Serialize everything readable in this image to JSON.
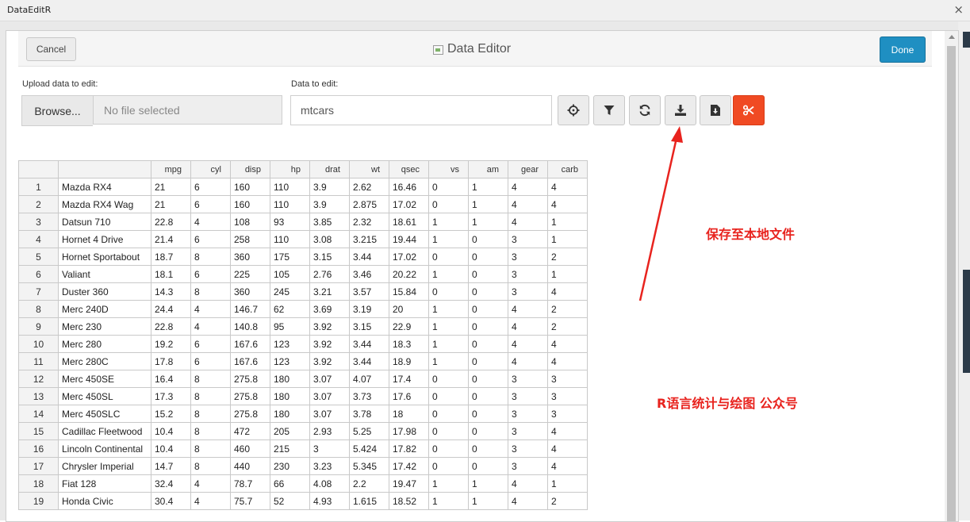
{
  "window": {
    "title": "DataEditR",
    "close_glyph": "×"
  },
  "header": {
    "cancel_label": "Cancel",
    "title": "Data Editor",
    "done_label": "Done"
  },
  "upload": {
    "label": "Upload data to edit:",
    "browse_label": "Browse...",
    "file_placeholder": "No file selected"
  },
  "data_select": {
    "label": "Data to edit:",
    "value": "mtcars"
  },
  "toolbar": {
    "icons": [
      "crosshairs-icon",
      "filter-icon",
      "sync-icon",
      "download-icon",
      "file-download-icon",
      "cut-icon"
    ]
  },
  "colors": {
    "done": "#1f8fc2",
    "cut": "#f04a23",
    "annotation": "#e8231e"
  },
  "table": {
    "columns": [
      "",
      "",
      "mpg",
      "cyl",
      "disp",
      "hp",
      "drat",
      "wt",
      "qsec",
      "vs",
      "am",
      "gear",
      "carb"
    ],
    "rows": [
      [
        "1",
        "Mazda RX4",
        "21",
        "6",
        "160",
        "110",
        "3.9",
        "2.62",
        "16.46",
        "0",
        "1",
        "4",
        "4"
      ],
      [
        "2",
        "Mazda RX4 Wag",
        "21",
        "6",
        "160",
        "110",
        "3.9",
        "2.875",
        "17.02",
        "0",
        "1",
        "4",
        "4"
      ],
      [
        "3",
        "Datsun 710",
        "22.8",
        "4",
        "108",
        "93",
        "3.85",
        "2.32",
        "18.61",
        "1",
        "1",
        "4",
        "1"
      ],
      [
        "4",
        "Hornet 4 Drive",
        "21.4",
        "6",
        "258",
        "110",
        "3.08",
        "3.215",
        "19.44",
        "1",
        "0",
        "3",
        "1"
      ],
      [
        "5",
        "Hornet Sportabout",
        "18.7",
        "8",
        "360",
        "175",
        "3.15",
        "3.44",
        "17.02",
        "0",
        "0",
        "3",
        "2"
      ],
      [
        "6",
        "Valiant",
        "18.1",
        "6",
        "225",
        "105",
        "2.76",
        "3.46",
        "20.22",
        "1",
        "0",
        "3",
        "1"
      ],
      [
        "7",
        "Duster 360",
        "14.3",
        "8",
        "360",
        "245",
        "3.21",
        "3.57",
        "15.84",
        "0",
        "0",
        "3",
        "4"
      ],
      [
        "8",
        "Merc 240D",
        "24.4",
        "4",
        "146.7",
        "62",
        "3.69",
        "3.19",
        "20",
        "1",
        "0",
        "4",
        "2"
      ],
      [
        "9",
        "Merc 230",
        "22.8",
        "4",
        "140.8",
        "95",
        "3.92",
        "3.15",
        "22.9",
        "1",
        "0",
        "4",
        "2"
      ],
      [
        "10",
        "Merc 280",
        "19.2",
        "6",
        "167.6",
        "123",
        "3.92",
        "3.44",
        "18.3",
        "1",
        "0",
        "4",
        "4"
      ],
      [
        "11",
        "Merc 280C",
        "17.8",
        "6",
        "167.6",
        "123",
        "3.92",
        "3.44",
        "18.9",
        "1",
        "0",
        "4",
        "4"
      ],
      [
        "12",
        "Merc 450SE",
        "16.4",
        "8",
        "275.8",
        "180",
        "3.07",
        "4.07",
        "17.4",
        "0",
        "0",
        "3",
        "3"
      ],
      [
        "13",
        "Merc 450SL",
        "17.3",
        "8",
        "275.8",
        "180",
        "3.07",
        "3.73",
        "17.6",
        "0",
        "0",
        "3",
        "3"
      ],
      [
        "14",
        "Merc 450SLC",
        "15.2",
        "8",
        "275.8",
        "180",
        "3.07",
        "3.78",
        "18",
        "0",
        "0",
        "3",
        "3"
      ],
      [
        "15",
        "Cadillac Fleetwood",
        "10.4",
        "8",
        "472",
        "205",
        "2.93",
        "5.25",
        "17.98",
        "0",
        "0",
        "3",
        "4"
      ],
      [
        "16",
        "Lincoln Continental",
        "10.4",
        "8",
        "460",
        "215",
        "3",
        "5.424",
        "17.82",
        "0",
        "0",
        "3",
        "4"
      ],
      [
        "17",
        "Chrysler Imperial",
        "14.7",
        "8",
        "440",
        "230",
        "3.23",
        "5.345",
        "17.42",
        "0",
        "0",
        "3",
        "4"
      ],
      [
        "18",
        "Fiat 128",
        "32.4",
        "4",
        "78.7",
        "66",
        "4.08",
        "2.2",
        "19.47",
        "1",
        "1",
        "4",
        "1"
      ],
      [
        "19",
        "Honda Civic",
        "30.4",
        "4",
        "75.7",
        "52",
        "4.93",
        "1.615",
        "18.52",
        "1",
        "1",
        "4",
        "2"
      ]
    ]
  },
  "annotations": {
    "save_local": "保存至本地文件",
    "watermark": "R语言统计与绘图 公众号"
  }
}
